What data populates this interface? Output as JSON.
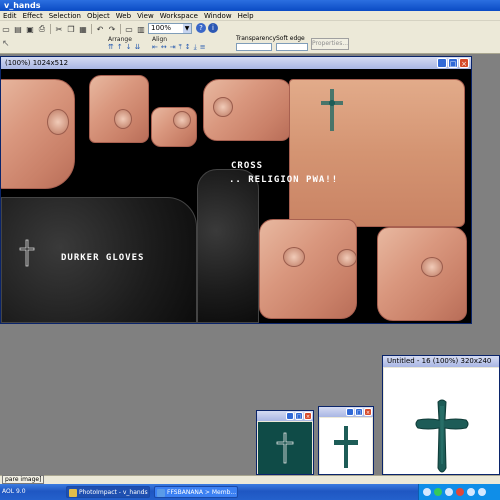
{
  "app": {
    "title": "v_hands"
  },
  "menu": {
    "items": [
      "Edit",
      "Effect",
      "Selection",
      "Object",
      "Web",
      "View",
      "Workspace",
      "Window",
      "Help"
    ]
  },
  "toolbar": {
    "zoom_value": "100%",
    "arrange_label": "Arrange",
    "align_label": "Align",
    "transparency_label": "Transparency",
    "soft_edge_label": "Soft edge",
    "properties_label": "Properties..."
  },
  "image_window": {
    "title": "(100%) 1024x512",
    "canvas_texts": {
      "cross": "CROSS",
      "religion": ".. RELIGION PWA!!",
      "gloves": "DURKER GLOVES"
    }
  },
  "thumbnails": [
    {
      "title": ""
    },
    {
      "title": ""
    }
  ],
  "untitled_window": {
    "title": "Untitled - 16 (100%) 320x240"
  },
  "statusbar": {
    "text": "pare image]"
  },
  "taskbar": {
    "aol": "AOL 9.0",
    "items": [
      "PhotoImpact - v_hands",
      "FFSBANANA > Memb..."
    ]
  },
  "colors": {
    "cross_teal": "#1d5c57",
    "thumb_bg": "#0f4b47",
    "accent": "#3169d6"
  }
}
